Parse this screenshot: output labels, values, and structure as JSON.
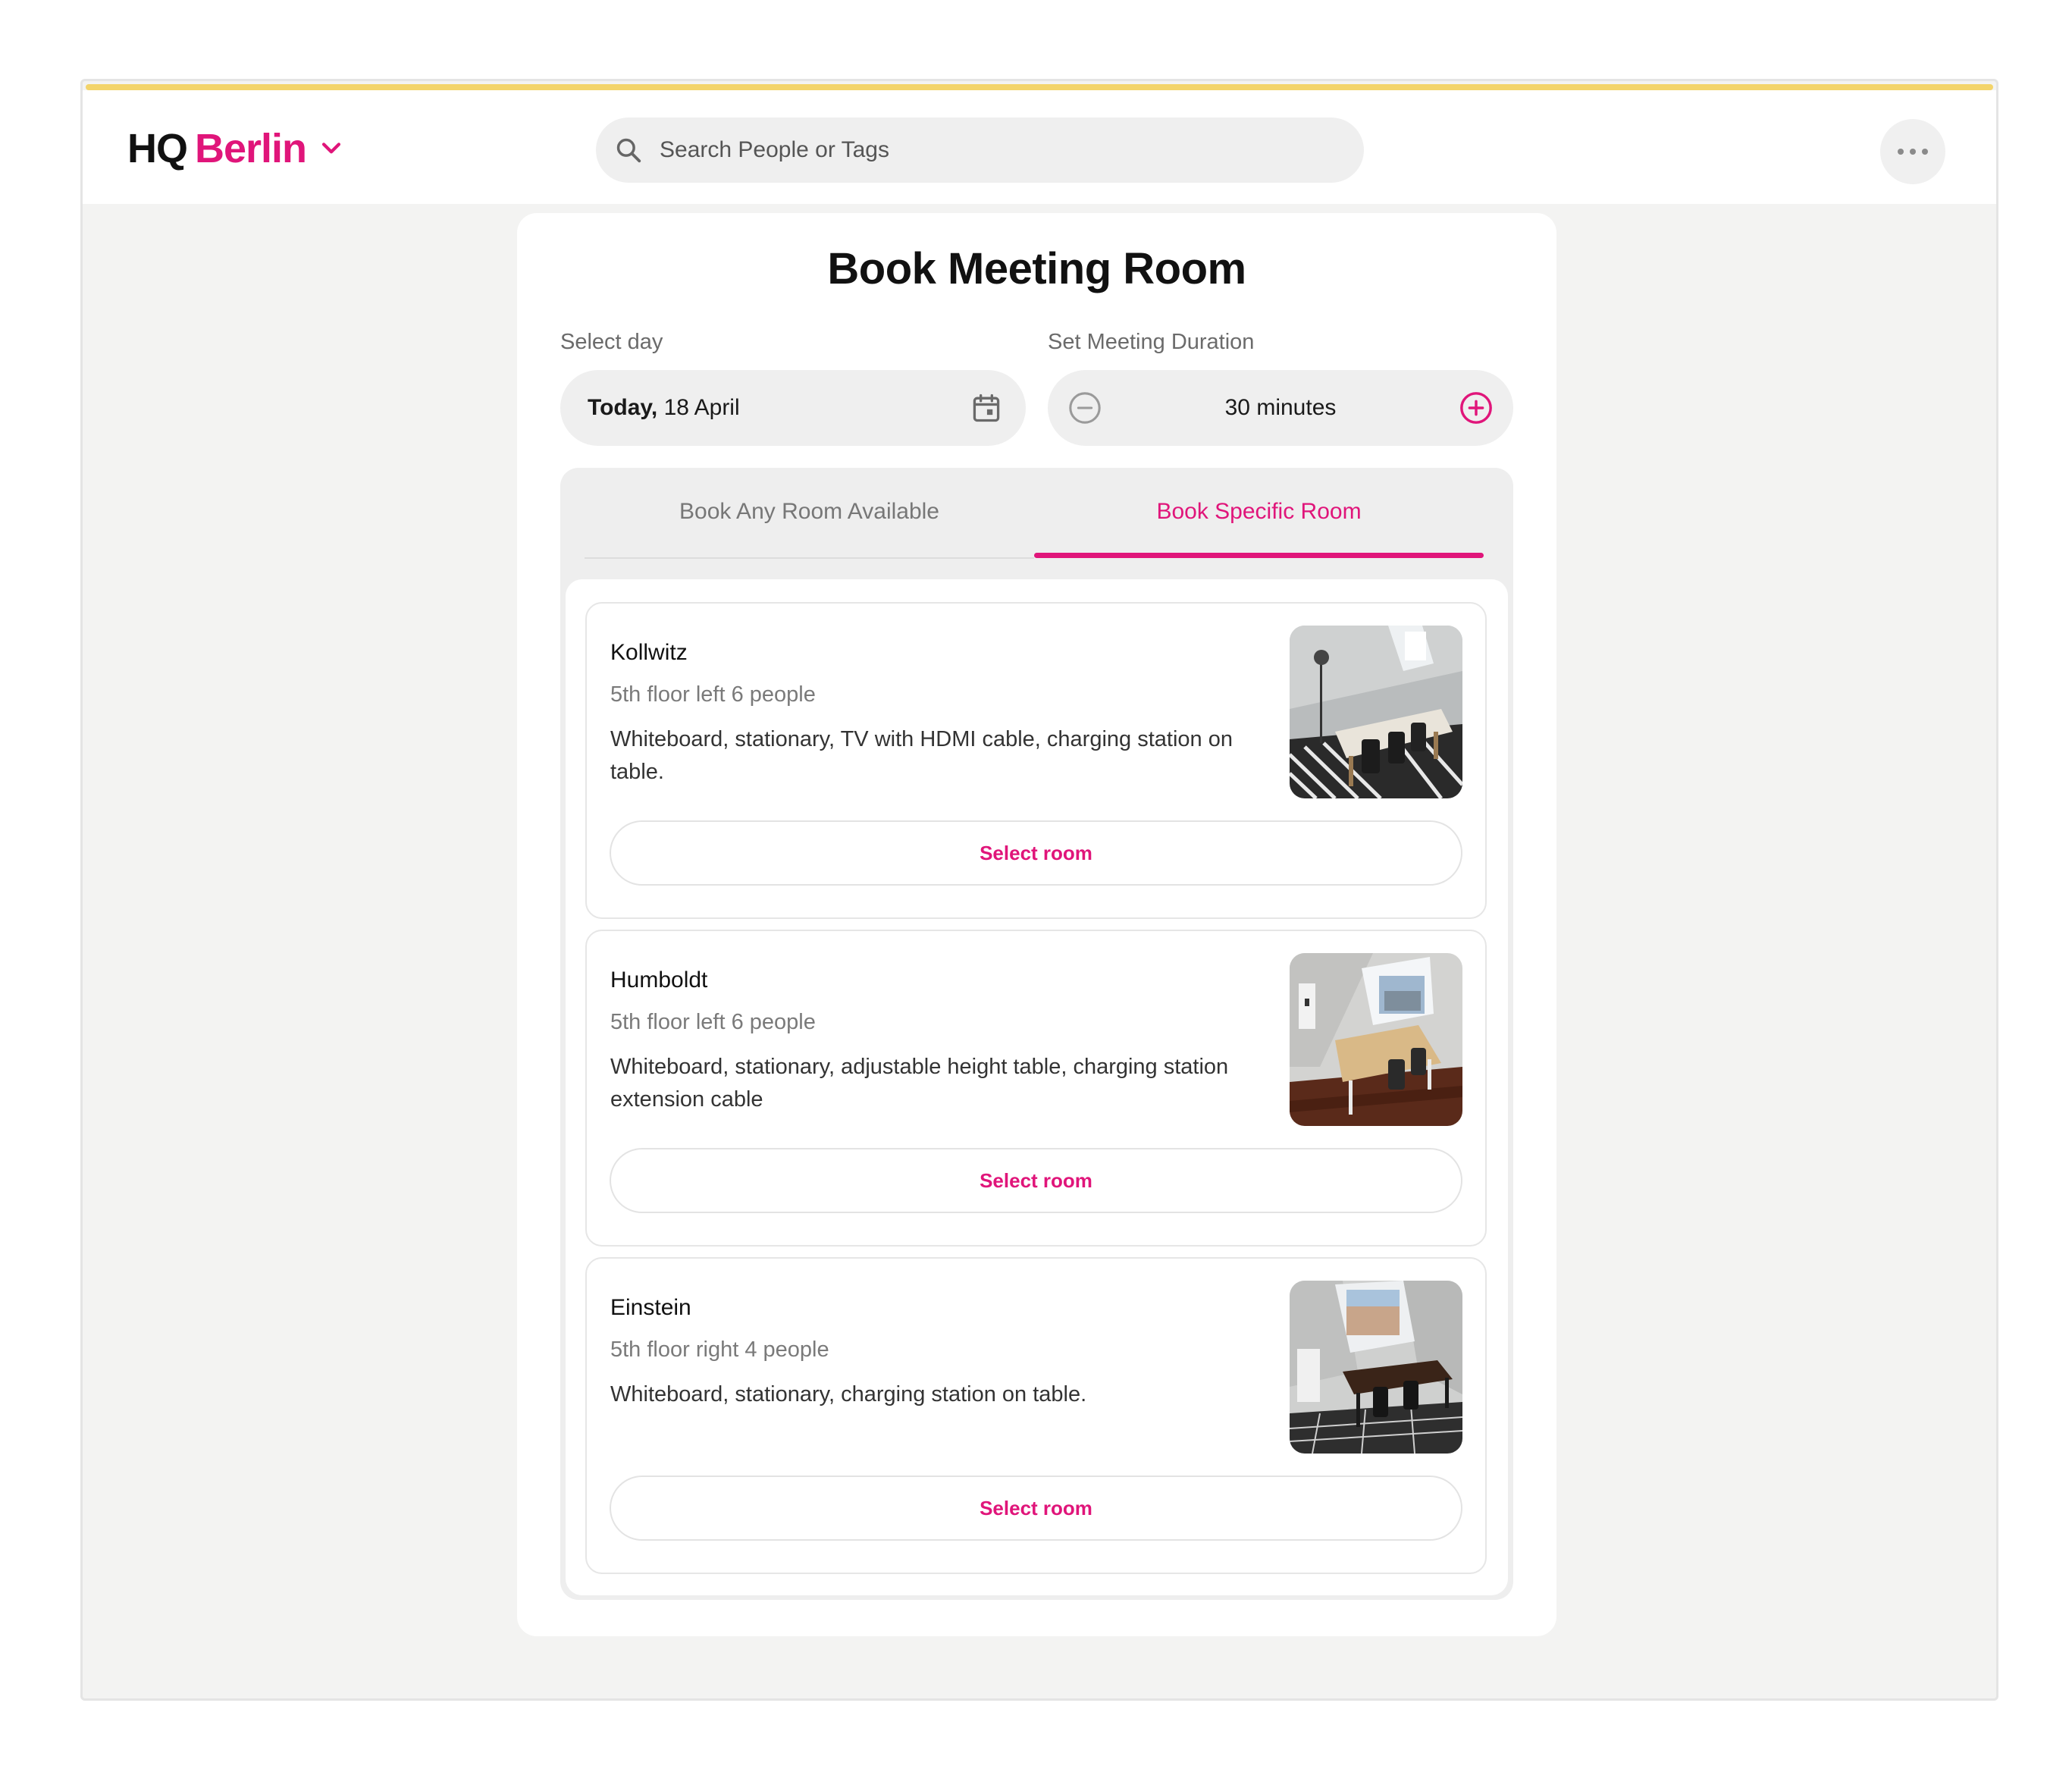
{
  "header": {
    "brand_hq": "HQ",
    "brand_city": "Berlin",
    "search_placeholder": "Search People or Tags"
  },
  "colors": {
    "accent": "#e0157a",
    "top_bar": "#f3d46a",
    "background": "#f3f3f2"
  },
  "booking": {
    "title": "Book Meeting Room",
    "day_label": "Select day",
    "day_prefix": "Today,",
    "day_value": " 18 April",
    "duration_label": "Set Meeting Duration",
    "duration_value": "30 minutes"
  },
  "tabs": [
    {
      "label": "Book Any Room Available",
      "active": false
    },
    {
      "label": "Book Specific Room",
      "active": true
    }
  ],
  "rooms": [
    {
      "name": "Kollwitz",
      "location": "5th floor left 6 people",
      "description": "Whiteboard, stationary, TV with HDMI cable, charging station on table.",
      "button_label": "Select room"
    },
    {
      "name": "Humboldt",
      "location": "5th floor left 6 people",
      "description": "Whiteboard, stationary, adjustable height table, charging station extension cable",
      "button_label": "Select room"
    },
    {
      "name": "Einstein",
      "location": "5th floor right 4 people",
      "description": "Whiteboard, stationary, charging station on table.",
      "button_label": "Select room"
    }
  ]
}
